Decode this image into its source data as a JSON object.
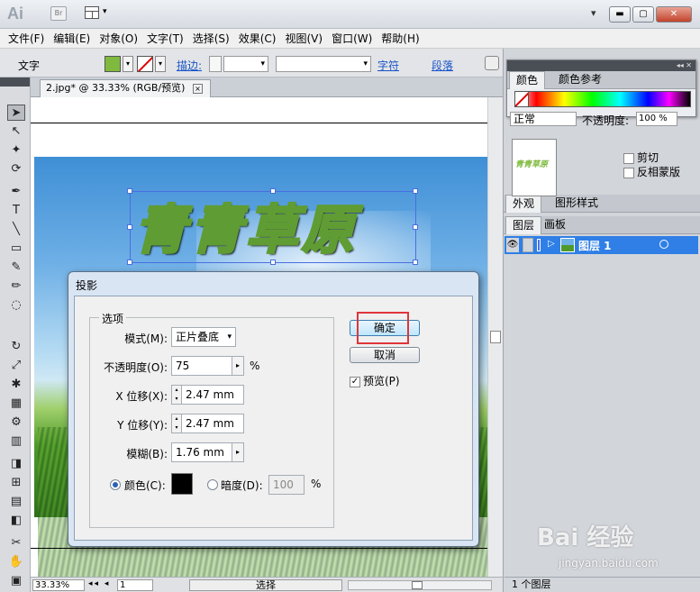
{
  "app": {
    "logo": "Ai",
    "bridge": "Br",
    "arrange_caret": "▾",
    "ws_caret": "▾",
    "win_min": "▬",
    "win_max": "▢",
    "win_close": "✕"
  },
  "menu": [
    "文件(F)",
    "编辑(E)",
    "对象(O)",
    "文字(T)",
    "选择(S)",
    "效果(C)",
    "视图(V)",
    "窗口(W)",
    "帮助(H)"
  ],
  "control": {
    "mode_label": "文字",
    "stroke_link": "描边:",
    "char_link": "字符",
    "para_link": "段落",
    "fill_color": "#7fba3f",
    "dd": "▾"
  },
  "tools": [
    "➤",
    "↖",
    "✦",
    "⟳",
    "✒",
    "T",
    "╲",
    "▭",
    "✎",
    "✏",
    "◌",
    "↻",
    "⤢",
    "✱",
    "▦",
    "⚙",
    "▥",
    "◨",
    "⊞",
    "▤",
    "◧",
    "✂",
    "✋",
    "◎",
    "▣"
  ],
  "document": {
    "tab_label": "2.jpg* @ 33.33% (RGB/预览)",
    "close": "×",
    "art_text": "青青草原"
  },
  "status": {
    "zoom": "33.33%",
    "page": "1",
    "tool": "选择",
    "nav": "◂◂ ◂",
    "arrow": "▸"
  },
  "color_panel": {
    "tab_color": "颜色",
    "tab_color_ref": "颜色参考",
    "grip": "◂◂ ✕"
  },
  "transparency": {
    "blend_mode": "正常",
    "opacity_label": "不透明度:",
    "opacity_value": "100 %",
    "clip_label": "剪切",
    "invert_label": "反相蒙版"
  },
  "appearance": {
    "tab_appearance": "外观",
    "tab_graphic_styles": "图形样式"
  },
  "layers": {
    "tab_layers": "图层",
    "tab_artboards": "画板",
    "layer_name": "图层 1",
    "footer": "1 个图层",
    "eye": "👁",
    "arrow": "▷"
  },
  "dialog": {
    "title": "投影",
    "options_label": "选项",
    "mode_label": "模式(M):",
    "mode_value": "正片叠底",
    "opacity_label": "不透明度(O):",
    "opacity_value": "75",
    "x_offset_label": "X 位移(X):",
    "x_offset_value": "2.47 mm",
    "y_offset_label": "Y 位移(Y):",
    "y_offset_value": "2.47 mm",
    "blur_label": "模糊(B):",
    "blur_value": "1.76 mm",
    "color_label": "颜色(C):",
    "darkness_label": "暗度(D):",
    "darkness_value": "100",
    "percent": "%",
    "ok_label": "确定",
    "cancel_label": "取消",
    "preview_label": "预览(P)",
    "preview_check": "✓",
    "shadow_color": "#000000",
    "caret": "▾",
    "spin_up": "▴",
    "spin_down": "▾",
    "spin_right": "▸"
  },
  "watermark": {
    "main": "Bai 经验",
    "sub": "jingyan.baidu.com"
  }
}
